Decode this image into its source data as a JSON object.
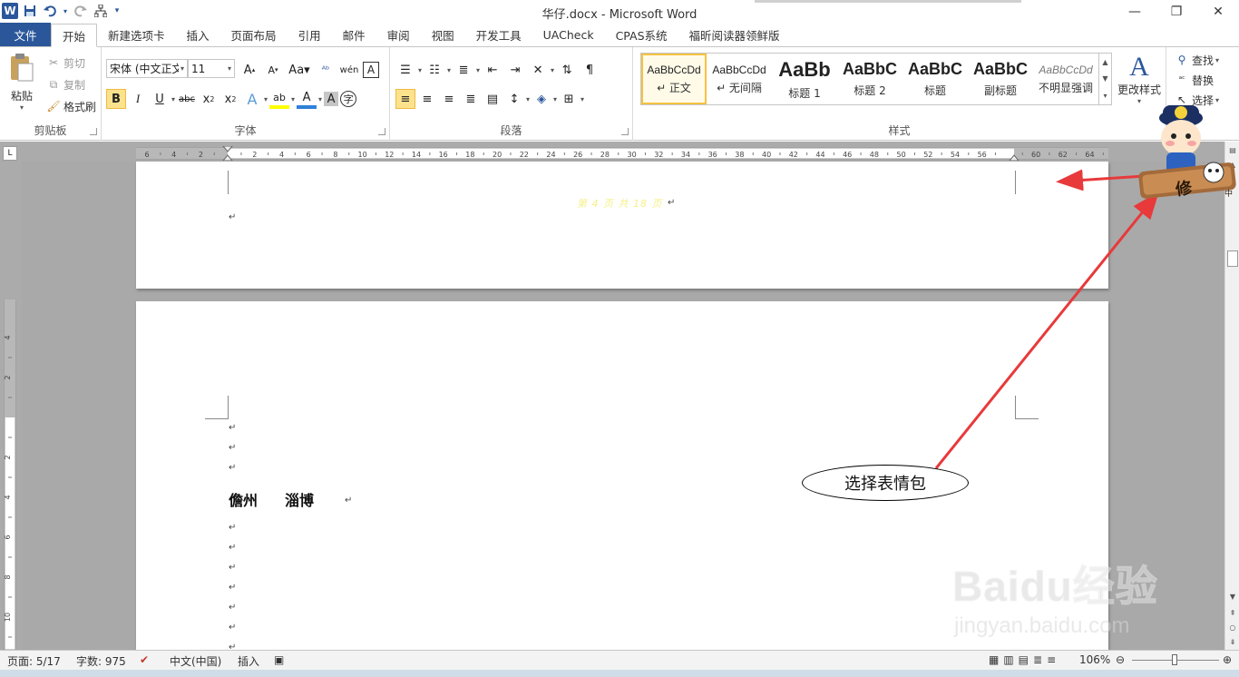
{
  "window": {
    "title": "华仔.docx  -  Microsoft Word",
    "app_icon": "W"
  },
  "qat": {
    "save_icon": "floppy-disk",
    "undo_icon": "undo",
    "redo_icon": "redo",
    "tree_icon": "org-chart"
  },
  "tabs": [
    "文件",
    "开始",
    "新建选项卡",
    "插入",
    "页面布局",
    "引用",
    "邮件",
    "审阅",
    "视图",
    "开发工具",
    "UACheck",
    "CPAS系统",
    "福昕阅读器领鲜版"
  ],
  "active_tab": "开始",
  "clipboard": {
    "paste": "粘贴",
    "cut": "剪切",
    "copy": "复制",
    "format_painter": "格式刷",
    "label": "剪贴板"
  },
  "font": {
    "family": "宋体 (中文正文)",
    "size": "11",
    "label": "字体"
  },
  "paragraph": {
    "label": "段落"
  },
  "styles": {
    "items": [
      {
        "sample": "AaBbCcDd",
        "name": "↵ 正文"
      },
      {
        "sample": "AaBbCcDd",
        "name": "↵ 无间隔"
      },
      {
        "sample": "AaBb",
        "name": "标题 1"
      },
      {
        "sample": "AaBbC",
        "name": "标题 2"
      },
      {
        "sample": "AaBbC",
        "name": "标题"
      },
      {
        "sample": "AaBbC",
        "name": "副标题"
      },
      {
        "sample": "AaBbCcDd",
        "name": "不明显强调"
      }
    ],
    "change_styles": "更改样式",
    "label": "样式"
  },
  "editing": {
    "find": "查找",
    "replace": "替换",
    "select": "选择"
  },
  "ruler": {
    "h_ticks": [
      "6",
      "4",
      "2",
      "",
      "2",
      "4",
      "6",
      "8",
      "10",
      "12",
      "14",
      "16",
      "18",
      "20",
      "22",
      "24",
      "26",
      "28",
      "30",
      "32",
      "34",
      "36",
      "38",
      "40",
      "42",
      "44",
      "46",
      "48",
      "50",
      "52",
      "54",
      "56",
      "",
      "60",
      "62",
      "64"
    ],
    "v_ticks": [
      "4",
      "2",
      "",
      "2",
      "4",
      "6",
      "8",
      "10"
    ]
  },
  "document": {
    "header_text": "第 4 页  共 18 页",
    "para_mark": "↵",
    "body_line": {
      "left": "儋州",
      "right": "淄博"
    }
  },
  "status": {
    "page": "页面: 5/17",
    "words": "字数: 975",
    "language": "中文(中国)",
    "insert": "插入",
    "zoom": "106%"
  },
  "annotation": {
    "callout_text": "选择表情包",
    "arrow_color": "#e8393b"
  },
  "sticker": {
    "board_text": "修",
    "board_small": "中"
  },
  "watermark": {
    "logo": "Baidu经验",
    "url": "jingyan.baidu.com"
  }
}
